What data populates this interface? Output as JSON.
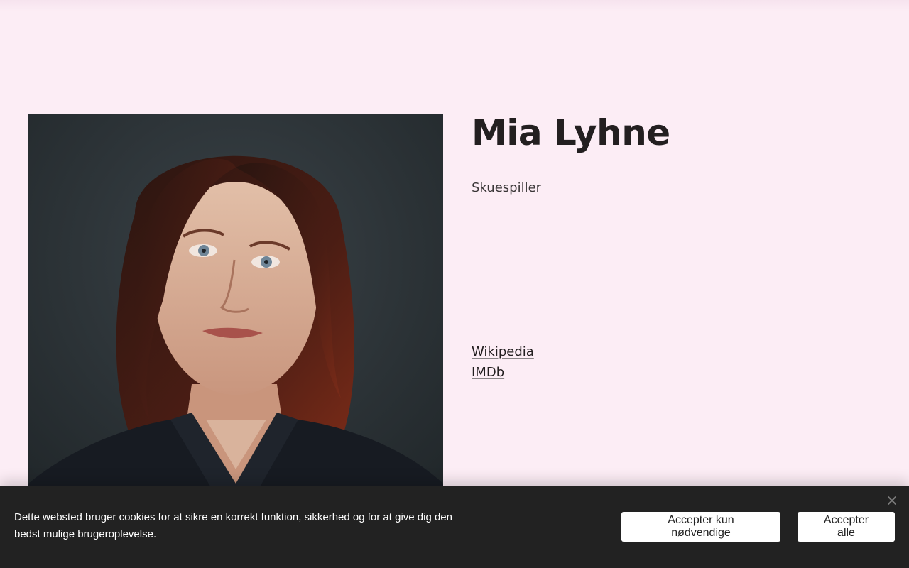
{
  "person": {
    "name": "Mia Lyhne",
    "role": "Skuespiller",
    "links": [
      {
        "label": "Wikipedia"
      },
      {
        "label": "IMDb"
      }
    ]
  },
  "cookie": {
    "message": "Dette websted bruger cookies for at sikre en korrekt funktion, sikkerhed og for at give dig den bedst mulige brugeroplevelse.",
    "accept_necessary_label": "Accepter kun nødvendige",
    "accept_all_label": "Accepter alle",
    "close_icon": "close-icon"
  },
  "colors": {
    "page_background": "#fcedf5",
    "text": "#231f20",
    "banner_background": "#222222"
  }
}
